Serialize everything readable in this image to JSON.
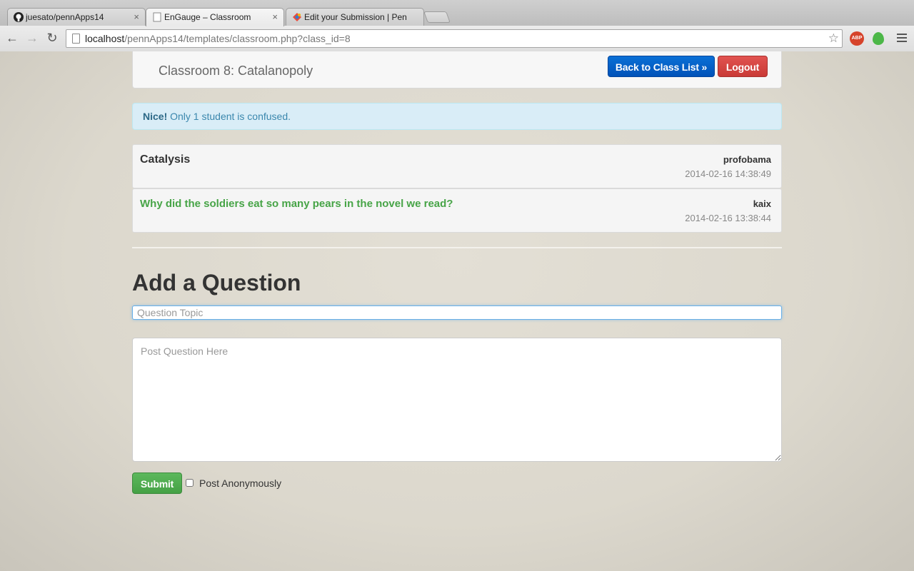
{
  "browser": {
    "tabs": [
      {
        "label": "juesato/pennApps14",
        "icon": "github-icon"
      },
      {
        "label": "EnGauge – Classroom",
        "icon": "page-icon"
      },
      {
        "label": "Edit your Submission | Pen",
        "icon": "devpost-icon"
      }
    ],
    "close_glyph": "×",
    "url_host": "localhost",
    "url_path": "/pennApps14/templates/classroom.php?class_id=8",
    "abp_label": "ABP"
  },
  "header": {
    "title": "Classroom 8: Catalanopoly",
    "back_label": "Back to Class List »",
    "logout_label": "Logout"
  },
  "alert": {
    "strong": "Nice!",
    "message": " Only 1 student is confused."
  },
  "questions": [
    {
      "title": "Catalysis",
      "author": "profobama",
      "time": "2014-02-16 14:38:49"
    },
    {
      "title": "Why did the soldiers eat so many pears in the novel we read?",
      "author": "kaix",
      "time": "2014-02-16 13:38:44"
    }
  ],
  "form": {
    "heading": "Add a Question",
    "topic_placeholder": "Question Topic",
    "post_placeholder": "Post Question Here",
    "submit_label": "Submit",
    "anon_label": "Post Anonymously"
  },
  "colors": {
    "primary": "#0066cc",
    "danger": "#d9534f",
    "success": "#5cb85c",
    "alert_bg": "#d9edf7",
    "question_green": "#47a447"
  }
}
